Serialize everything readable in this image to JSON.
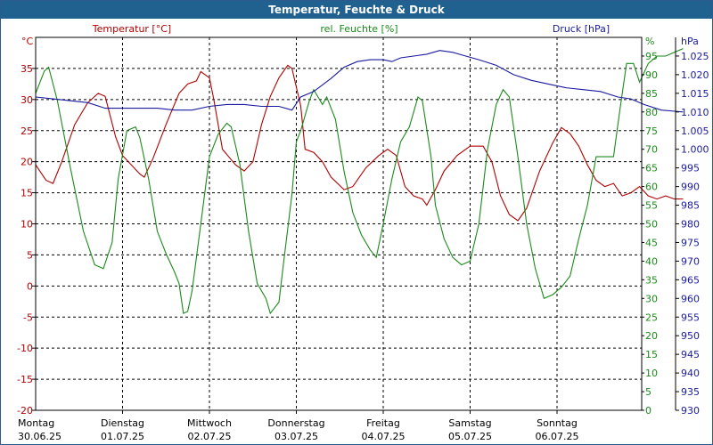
{
  "chart_data": {
    "type": "line",
    "title": "Temperatur, Feuchte & Druck",
    "x": {
      "categories": [
        {
          "day": "Montag",
          "date": "30.06.25"
        },
        {
          "day": "Dienstag",
          "date": "01.07.25"
        },
        {
          "day": "Mittwoch",
          "date": "02.07.25"
        },
        {
          "day": "Donnerstag",
          "date": "03.07.25"
        },
        {
          "day": "Freitag",
          "date": "04.07.25"
        },
        {
          "day": "Samstag",
          "date": "05.07.25"
        },
        {
          "day": "Sonntag",
          "date": "06.07.25"
        }
      ],
      "range_days": [
        0,
        7
      ]
    },
    "axes": {
      "temperature": {
        "label": "Temperatur [°C]",
        "unit": "°C",
        "range": [
          -20,
          40
        ],
        "step": 5,
        "color": "#b00000"
      },
      "humidity": {
        "label": "rel. Feuchte [%]",
        "unit": "%",
        "range": [
          0,
          100
        ],
        "step": 5,
        "color": "#1a8a1a"
      },
      "pressure": {
        "label": "Druck [hPa]",
        "unit": "hPa",
        "range": [
          930,
          1030
        ],
        "step": 5,
        "color": "#1a1aa0"
      }
    },
    "grid": true,
    "series": [
      {
        "name": "Temperatur [°C]",
        "axis": "temperature",
        "color": "#b00000",
        "points": [
          [
            0.0,
            19.5
          ],
          [
            0.12,
            17.0
          ],
          [
            0.2,
            16.5
          ],
          [
            0.3,
            20.0
          ],
          [
            0.45,
            26.0
          ],
          [
            0.6,
            29.5
          ],
          [
            0.72,
            31.0
          ],
          [
            0.8,
            30.5
          ],
          [
            0.92,
            24.0
          ],
          [
            1.0,
            21.0
          ],
          [
            1.1,
            19.5
          ],
          [
            1.2,
            18.0
          ],
          [
            1.25,
            17.5
          ],
          [
            1.35,
            20.5
          ],
          [
            1.5,
            26.0
          ],
          [
            1.65,
            31.0
          ],
          [
            1.75,
            32.5
          ],
          [
            1.85,
            33.0
          ],
          [
            1.9,
            34.5
          ],
          [
            2.0,
            33.5
          ],
          [
            2.05,
            30.0
          ],
          [
            2.15,
            22.0
          ],
          [
            2.3,
            19.5
          ],
          [
            2.4,
            18.5
          ],
          [
            2.5,
            20.0
          ],
          [
            2.6,
            26.0
          ],
          [
            2.7,
            30.5
          ],
          [
            2.8,
            33.5
          ],
          [
            2.9,
            35.5
          ],
          [
            2.95,
            35.0
          ],
          [
            3.05,
            29.0
          ],
          [
            3.1,
            22.0
          ],
          [
            3.2,
            21.5
          ],
          [
            3.3,
            20.0
          ],
          [
            3.4,
            17.5
          ],
          [
            3.55,
            15.5
          ],
          [
            3.65,
            16.0
          ],
          [
            3.8,
            19.0
          ],
          [
            3.95,
            21.0
          ],
          [
            4.05,
            22.0
          ],
          [
            4.15,
            21.0
          ],
          [
            4.25,
            16.0
          ],
          [
            4.35,
            14.5
          ],
          [
            4.45,
            14.0
          ],
          [
            4.5,
            13.0
          ],
          [
            4.6,
            15.5
          ],
          [
            4.7,
            18.5
          ],
          [
            4.85,
            21.0
          ],
          [
            5.0,
            22.5
          ],
          [
            5.15,
            22.5
          ],
          [
            5.25,
            20.0
          ],
          [
            5.35,
            14.5
          ],
          [
            5.45,
            11.5
          ],
          [
            5.55,
            10.5
          ],
          [
            5.65,
            12.5
          ],
          [
            5.8,
            18.5
          ],
          [
            5.95,
            23.0
          ],
          [
            6.05,
            25.5
          ],
          [
            6.15,
            24.5
          ],
          [
            6.25,
            22.5
          ],
          [
            6.35,
            19.5
          ],
          [
            6.45,
            17.0
          ],
          [
            6.55,
            16.0
          ],
          [
            6.65,
            16.5
          ],
          [
            6.75,
            14.5
          ],
          [
            6.85,
            15.0
          ],
          [
            6.95,
            16.0
          ],
          [
            7.05,
            14.5
          ],
          [
            7.15,
            14.0
          ],
          [
            7.25,
            14.5
          ],
          [
            7.35,
            14.0
          ],
          [
            7.45,
            14.0
          ]
        ]
      },
      {
        "name": "rel. Feuchte [%]",
        "axis": "humidity",
        "color": "#1a8a1a",
        "points": [
          [
            0.0,
            85.0
          ],
          [
            0.1,
            91.0
          ],
          [
            0.15,
            92.0
          ],
          [
            0.25,
            83.0
          ],
          [
            0.4,
            65.0
          ],
          [
            0.55,
            48.0
          ],
          [
            0.68,
            39.0
          ],
          [
            0.78,
            38.0
          ],
          [
            0.88,
            45.0
          ],
          [
            0.95,
            62.0
          ],
          [
            1.05,
            75.0
          ],
          [
            1.15,
            76.0
          ],
          [
            1.2,
            73.0
          ],
          [
            1.3,
            62.0
          ],
          [
            1.4,
            48.0
          ],
          [
            1.5,
            42.0
          ],
          [
            1.6,
            37.0
          ],
          [
            1.65,
            34.0
          ],
          [
            1.7,
            26.0
          ],
          [
            1.75,
            26.5
          ],
          [
            1.8,
            32.0
          ],
          [
            1.9,
            50.0
          ],
          [
            2.0,
            68.0
          ],
          [
            2.1,
            74.0
          ],
          [
            2.2,
            77.0
          ],
          [
            2.25,
            76.0
          ],
          [
            2.35,
            66.0
          ],
          [
            2.45,
            48.0
          ],
          [
            2.55,
            34.0
          ],
          [
            2.65,
            30.0
          ],
          [
            2.7,
            26.0
          ],
          [
            2.75,
            27.5
          ],
          [
            2.8,
            29.0
          ],
          [
            2.85,
            39.0
          ],
          [
            2.95,
            58.0
          ],
          [
            3.0,
            72.0
          ],
          [
            3.05,
            75.0
          ],
          [
            3.15,
            83.0
          ],
          [
            3.2,
            86.0
          ],
          [
            3.3,
            82.0
          ],
          [
            3.35,
            84.0
          ],
          [
            3.45,
            78.0
          ],
          [
            3.55,
            64.0
          ],
          [
            3.65,
            53.0
          ],
          [
            3.75,
            47.0
          ],
          [
            3.85,
            43.0
          ],
          [
            3.92,
            41.0
          ],
          [
            4.0,
            50.0
          ],
          [
            4.1,
            62.0
          ],
          [
            4.2,
            72.0
          ],
          [
            4.3,
            76.0
          ],
          [
            4.4,
            84.0
          ],
          [
            4.45,
            83.0
          ],
          [
            4.55,
            68.0
          ],
          [
            4.6,
            55.0
          ],
          [
            4.7,
            46.0
          ],
          [
            4.8,
            41.0
          ],
          [
            4.9,
            39.0
          ],
          [
            5.0,
            40.0
          ],
          [
            5.1,
            50.0
          ],
          [
            5.2,
            70.0
          ],
          [
            5.3,
            82.0
          ],
          [
            5.38,
            86.0
          ],
          [
            5.45,
            84.0
          ],
          [
            5.55,
            68.0
          ],
          [
            5.65,
            50.0
          ],
          [
            5.75,
            38.0
          ],
          [
            5.85,
            30.0
          ],
          [
            5.95,
            31.0
          ],
          [
            6.05,
            33.0
          ],
          [
            6.15,
            36.0
          ],
          [
            6.25,
            46.0
          ],
          [
            6.35,
            55.0
          ],
          [
            6.45,
            68.0
          ],
          [
            6.55,
            68.0
          ],
          [
            6.65,
            68.0
          ],
          [
            6.72,
            80.0
          ],
          [
            6.8,
            93.0
          ],
          [
            6.88,
            93.0
          ],
          [
            6.95,
            88.0
          ],
          [
            7.05,
            93.0
          ],
          [
            7.15,
            95.0
          ],
          [
            7.25,
            95.0
          ],
          [
            7.35,
            96.0
          ],
          [
            7.45,
            97.0
          ]
        ]
      },
      {
        "name": "Druck [hPa]",
        "axis": "pressure",
        "color": "#1a1aa0",
        "points": [
          [
            0.0,
            1014.0
          ],
          [
            0.2,
            1013.5
          ],
          [
            0.4,
            1013.0
          ],
          [
            0.6,
            1012.5
          ],
          [
            0.8,
            1011.0
          ],
          [
            1.0,
            1011.0
          ],
          [
            1.2,
            1011.0
          ],
          [
            1.4,
            1011.0
          ],
          [
            1.6,
            1010.5
          ],
          [
            1.8,
            1010.5
          ],
          [
            2.0,
            1011.5
          ],
          [
            2.2,
            1012.0
          ],
          [
            2.4,
            1012.0
          ],
          [
            2.6,
            1011.5
          ],
          [
            2.8,
            1011.5
          ],
          [
            2.95,
            1010.5
          ],
          [
            3.05,
            1014.0
          ],
          [
            3.2,
            1015.5
          ],
          [
            3.4,
            1019.0
          ],
          [
            3.55,
            1022.0
          ],
          [
            3.7,
            1023.5
          ],
          [
            3.85,
            1024.0
          ],
          [
            4.0,
            1024.0
          ],
          [
            4.1,
            1023.5
          ],
          [
            4.2,
            1024.5
          ],
          [
            4.35,
            1025.0
          ],
          [
            4.5,
            1025.5
          ],
          [
            4.65,
            1026.5
          ],
          [
            4.8,
            1026.0
          ],
          [
            4.95,
            1025.0
          ],
          [
            5.1,
            1024.0
          ],
          [
            5.3,
            1022.5
          ],
          [
            5.5,
            1020.0
          ],
          [
            5.7,
            1018.5
          ],
          [
            5.9,
            1017.5
          ],
          [
            6.1,
            1016.5
          ],
          [
            6.3,
            1016.0
          ],
          [
            6.5,
            1015.5
          ],
          [
            6.7,
            1014.0
          ],
          [
            6.85,
            1013.5
          ],
          [
            7.0,
            1012.0
          ],
          [
            7.2,
            1010.5
          ],
          [
            7.45,
            1010.0
          ]
        ]
      }
    ]
  }
}
